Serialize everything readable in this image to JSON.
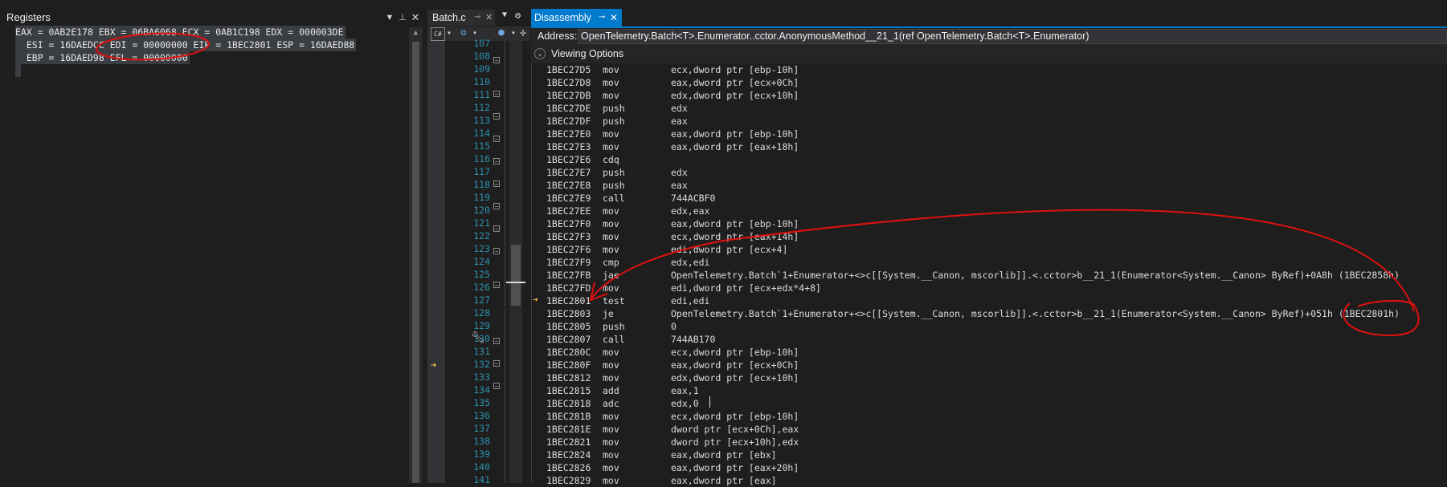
{
  "registers_pane": {
    "title": "Registers",
    "rows": [
      "EAX = 0AB2E178 EBX = 06BA6068 ECX = 0AB1C198 EDX = 000003DE",
      "  ESI = 16DAEDCC EDI = 00000000 EIP = 1BEC2801 ESP = 16DAED88",
      "  EBP = 16DAED98 EFL = 00000000"
    ]
  },
  "batch_pane": {
    "tab_label": "Batch.c",
    "line_numbers": [
      "107",
      "108",
      "109",
      "110",
      "111",
      "112",
      "113",
      "114",
      "115",
      "116",
      "117",
      "118",
      "119",
      "120",
      "121",
      "122",
      "123",
      "124",
      "125",
      "126",
      "127",
      "128",
      "129",
      "130",
      "131",
      "132",
      "133",
      "134",
      "135",
      "136",
      "137",
      "138",
      "139",
      "140",
      "141"
    ]
  },
  "disassembly": {
    "tab_label": "Disassembly",
    "address_label": "Address:",
    "address_value": "OpenTelemetry.Batch<T>.Enumerator..cctor.AnonymousMethod__21_1(ref OpenTelemetry.Batch<T>.Enumerator)",
    "viewing_options_label": "Viewing Options",
    "lines": [
      {
        "addr": "1BEC27D5",
        "mnem": "mov",
        "ops": "ecx,dword ptr [ebp-10h]"
      },
      {
        "addr": "1BEC27D8",
        "mnem": "mov",
        "ops": "eax,dword ptr [ecx+0Ch]"
      },
      {
        "addr": "1BEC27DB",
        "mnem": "mov",
        "ops": "edx,dword ptr [ecx+10h]"
      },
      {
        "addr": "1BEC27DE",
        "mnem": "push",
        "ops": "edx"
      },
      {
        "addr": "1BEC27DF",
        "mnem": "push",
        "ops": "eax"
      },
      {
        "addr": "1BEC27E0",
        "mnem": "mov",
        "ops": "eax,dword ptr [ebp-10h]"
      },
      {
        "addr": "1BEC27E3",
        "mnem": "mov",
        "ops": "eax,dword ptr [eax+18h]"
      },
      {
        "addr": "1BEC27E6",
        "mnem": "cdq",
        "ops": ""
      },
      {
        "addr": "1BEC27E7",
        "mnem": "push",
        "ops": "edx"
      },
      {
        "addr": "1BEC27E8",
        "mnem": "push",
        "ops": "eax"
      },
      {
        "addr": "1BEC27E9",
        "mnem": "call",
        "ops": "744ACBF0"
      },
      {
        "addr": "1BEC27EE",
        "mnem": "mov",
        "ops": "edx,eax"
      },
      {
        "addr": "1BEC27F0",
        "mnem": "mov",
        "ops": "eax,dword ptr [ebp-10h]"
      },
      {
        "addr": "1BEC27F3",
        "mnem": "mov",
        "ops": "ecx,dword ptr [eax+14h]"
      },
      {
        "addr": "1BEC27F6",
        "mnem": "mov",
        "ops": "edi,dword ptr [ecx+4]"
      },
      {
        "addr": "1BEC27F9",
        "mnem": "cmp",
        "ops": "edx,edi"
      },
      {
        "addr": "1BEC27FB",
        "mnem": "jae",
        "ops": "OpenTelemetry.Batch`1+Enumerator+<>c[[System.__Canon, mscorlib]].<.cctor>b__21_1(Enumerator<System.__Canon> ByRef)+0A8h (1BEC2858h)"
      },
      {
        "addr": "1BEC27FD",
        "mnem": "mov",
        "ops": "edi,dword ptr [ecx+edx*4+8]"
      },
      {
        "addr": "1BEC2801",
        "mnem": "test",
        "ops": "edi,edi"
      },
      {
        "addr": "1BEC2803",
        "mnem": "je",
        "ops": "OpenTelemetry.Batch`1+Enumerator+<>c[[System.__Canon, mscorlib]].<.cctor>b__21_1(Enumerator<System.__Canon> ByRef)+051h (1BEC2801h)"
      },
      {
        "addr": "1BEC2805",
        "mnem": "push",
        "ops": "0"
      },
      {
        "addr": "1BEC2807",
        "mnem": "call",
        "ops": "744AB170"
      },
      {
        "addr": "1BEC280C",
        "mnem": "mov",
        "ops": "ecx,dword ptr [ebp-10h]"
      },
      {
        "addr": "1BEC280F",
        "mnem": "mov",
        "ops": "eax,dword ptr [ecx+0Ch]"
      },
      {
        "addr": "1BEC2812",
        "mnem": "mov",
        "ops": "edx,dword ptr [ecx+10h]"
      },
      {
        "addr": "1BEC2815",
        "mnem": "add",
        "ops": "eax,1"
      },
      {
        "addr": "1BEC2818",
        "mnem": "adc",
        "ops": "edx,0"
      },
      {
        "addr": "1BEC281B",
        "mnem": "mov",
        "ops": "ecx,dword ptr [ebp-10h]"
      },
      {
        "addr": "1BEC281E",
        "mnem": "mov",
        "ops": "dword ptr [ecx+0Ch],eax"
      },
      {
        "addr": "1BEC2821",
        "mnem": "mov",
        "ops": "dword ptr [ecx+10h],edx"
      },
      {
        "addr": "1BEC2824",
        "mnem": "mov",
        "ops": "eax,dword ptr [ebx]"
      },
      {
        "addr": "1BEC2826",
        "mnem": "mov",
        "ops": "eax,dword ptr [eax+20h]"
      },
      {
        "addr": "1BEC2829",
        "mnem": "mov",
        "ops": "eax,dword ptr [eax]"
      }
    ]
  },
  "colors": {
    "accent": "#007acc",
    "line_number": "#2b91af",
    "annotation": "#e01010"
  }
}
